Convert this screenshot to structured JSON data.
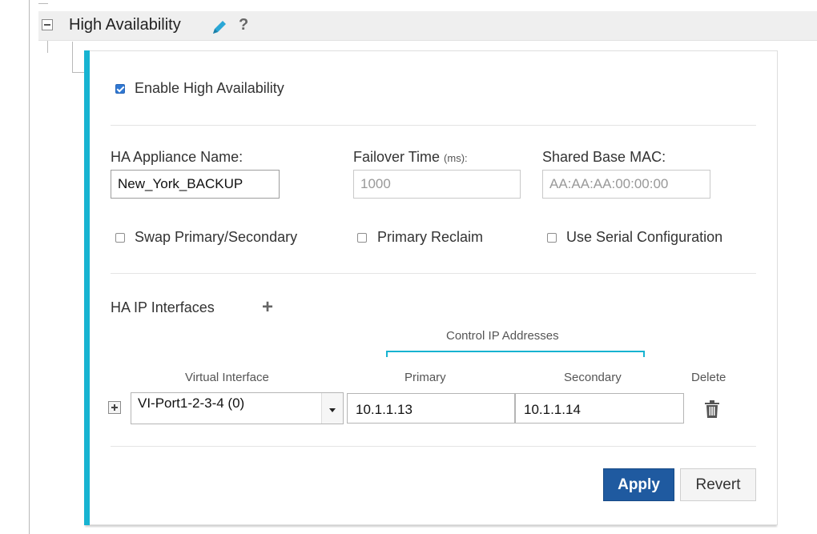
{
  "section": {
    "title": "High Availability",
    "edit_icon": "pencil-icon",
    "help_label": "?"
  },
  "enable_ha": {
    "label": "Enable High Availability",
    "checked": true
  },
  "fields": {
    "appliance_name": {
      "label": "HA Appliance Name:",
      "value": "New_York_BACKUP"
    },
    "failover_time": {
      "label": "Failover Time",
      "unit": "(ms):",
      "placeholder": "1000"
    },
    "shared_mac": {
      "label": "Shared Base MAC:",
      "placeholder": "AA:AA:AA:00:00:00"
    }
  },
  "options": {
    "swap": {
      "label": "Swap Primary/Secondary",
      "checked": false
    },
    "reclaim": {
      "label": "Primary Reclaim",
      "checked": false
    },
    "serial": {
      "label": "Use Serial Configuration",
      "checked": false
    }
  },
  "interfaces": {
    "title": "HA IP Interfaces",
    "add_label": "+",
    "group_header": "Control IP Addresses",
    "columns": {
      "virtual": "Virtual Interface",
      "primary": "Primary",
      "secondary": "Secondary",
      "delete": "Delete"
    },
    "rows": [
      {
        "virtual": "VI-Port1-2-3-4 (0)",
        "primary": "10.1.1.13",
        "secondary": "10.1.1.14"
      }
    ]
  },
  "buttons": {
    "apply": "Apply",
    "revert": "Revert"
  },
  "colors": {
    "accent": "#17b3d1",
    "apply_bg": "#1f5aa0",
    "checkbox_checked": "#2f78d3"
  }
}
